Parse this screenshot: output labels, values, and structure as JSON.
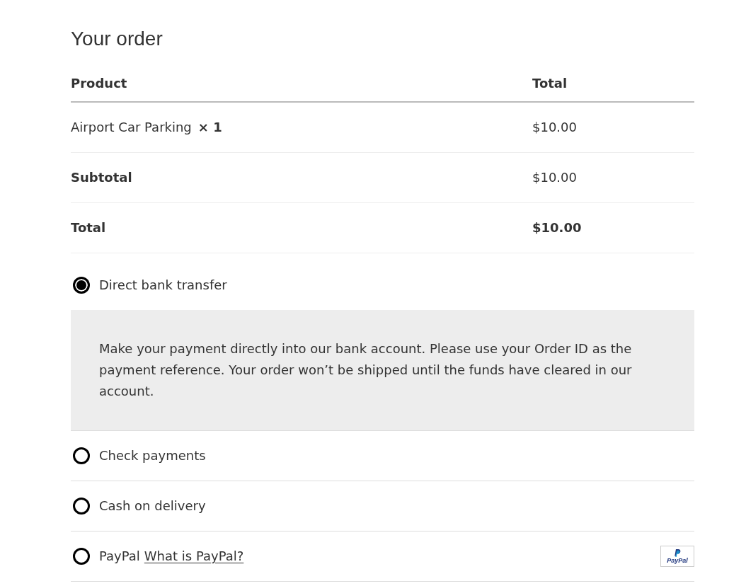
{
  "heading": "Your order",
  "table": {
    "columns": [
      "Product",
      "Total"
    ],
    "rows": [
      {
        "kind": "item",
        "product": "Airport Car Parking",
        "quantity": "× 1",
        "total": "$10.00"
      },
      {
        "kind": "subtotal",
        "label": "Subtotal",
        "total": "$10.00"
      },
      {
        "kind": "total",
        "label": "Total",
        "total": "$10.00"
      }
    ]
  },
  "payment_methods": [
    {
      "label": "Direct bank transfer",
      "selected": true,
      "description": "Make your payment directly into our bank account. Please use your Order ID as the payment reference. Your order won’t be shipped until the funds have cleared in our account."
    },
    {
      "label": "Check payments",
      "selected": false
    },
    {
      "label": "Cash on delivery",
      "selected": false
    },
    {
      "label": "PayPal",
      "selected": false,
      "link": "What is PayPal?",
      "logo_text": "PayPal"
    }
  ]
}
